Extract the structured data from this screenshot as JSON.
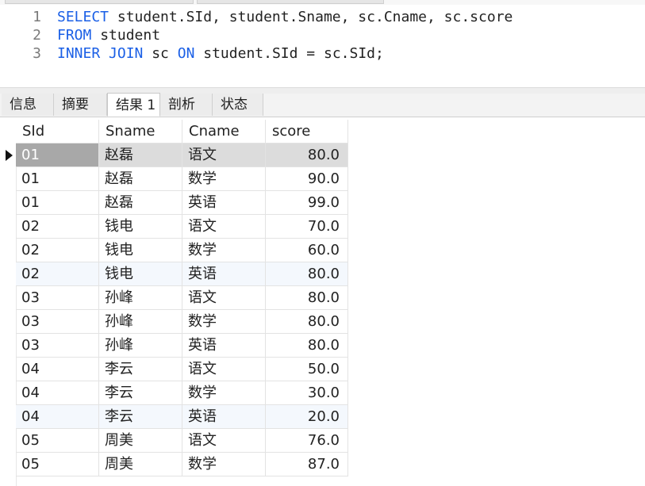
{
  "editor": {
    "lines": [
      {
        "num": "1",
        "parts": [
          {
            "t": "SELECT",
            "kw": true
          },
          {
            "t": " student.SId, student.Sname, sc.Cname, sc.score",
            "kw": false
          }
        ]
      },
      {
        "num": "2",
        "parts": [
          {
            "t": "FROM",
            "kw": true
          },
          {
            "t": " student",
            "kw": false
          }
        ]
      },
      {
        "num": "3",
        "parts": [
          {
            "t": "INNER JOIN",
            "kw": true
          },
          {
            "t": " sc ",
            "kw": false
          },
          {
            "t": "ON",
            "kw": true
          },
          {
            "t": " student.SId = sc.SId;",
            "kw": false
          }
        ]
      }
    ]
  },
  "tabs": [
    {
      "label": "信息",
      "active": false
    },
    {
      "label": "摘要",
      "active": false
    },
    {
      "label": "结果 1",
      "active": true
    },
    {
      "label": "剖析",
      "active": false
    },
    {
      "label": "状态",
      "active": false
    }
  ],
  "grid": {
    "columns": [
      "SId",
      "Sname",
      "Cname",
      "score"
    ],
    "selected_row": 0,
    "rows": [
      [
        "01",
        "赵磊",
        "语文",
        "80.0"
      ],
      [
        "01",
        "赵磊",
        "数学",
        "90.0"
      ],
      [
        "01",
        "赵磊",
        "英语",
        "99.0"
      ],
      [
        "02",
        "钱电",
        "语文",
        "70.0"
      ],
      [
        "02",
        "钱电",
        "数学",
        "60.0"
      ],
      [
        "02",
        "钱电",
        "英语",
        "80.0"
      ],
      [
        "03",
        "孙峰",
        "语文",
        "80.0"
      ],
      [
        "03",
        "孙峰",
        "数学",
        "80.0"
      ],
      [
        "03",
        "孙峰",
        "英语",
        "80.0"
      ],
      [
        "04",
        "李云",
        "语文",
        "50.0"
      ],
      [
        "04",
        "李云",
        "数学",
        "30.0"
      ],
      [
        "04",
        "李云",
        "英语",
        "20.0"
      ],
      [
        "05",
        "周美",
        "语文",
        "76.0"
      ],
      [
        "05",
        "周美",
        "数学",
        "87.0"
      ]
    ]
  },
  "colors": {
    "keyword": "#1a5fe6",
    "selected_row": "#dcdcdc",
    "selected_key_cell": "#a8a8a8"
  }
}
